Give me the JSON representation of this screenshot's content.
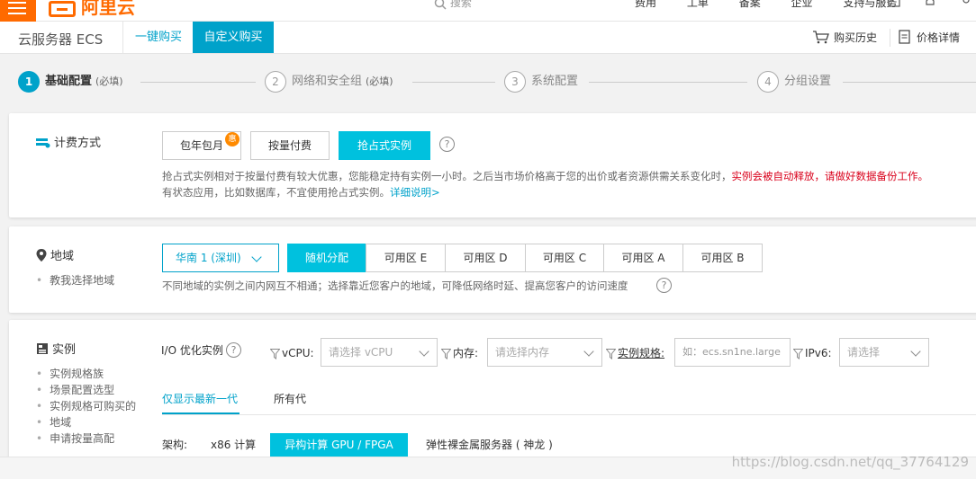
{
  "topbar": {
    "logo_text": "阿里云",
    "search_placeholder": "搜索",
    "nav": [
      "费用",
      "工单",
      "备案",
      "企业",
      "支持与服务"
    ],
    "brand_color": "#ff6a00"
  },
  "header": {
    "product_title": "云服务器 ECS",
    "tab_quick": "一键购买",
    "tab_custom": "自定义购买",
    "purchase_history": "购买历史",
    "price_detail": "价格详情",
    "accent_color": "#00a2ca"
  },
  "steps": [
    {
      "num": "1",
      "label": "基础配置",
      "req": "(必填)",
      "active": true
    },
    {
      "num": "2",
      "label": "网络和安全组",
      "req": "(必填)",
      "active": false
    },
    {
      "num": "3",
      "label": "系统配置",
      "req": "",
      "active": false
    },
    {
      "num": "4",
      "label": "分组设置",
      "req": "",
      "active": false
    }
  ],
  "billing": {
    "title": "计费方式",
    "options": [
      "包年包月",
      "按量付费",
      "抢占式实例"
    ],
    "selected": "抢占式实例",
    "badge": "惠",
    "help": "?",
    "desc_line1": "抢占式实例相对于按量付费有较大优惠，您能稳定持有实例一小时。之后当市场价格高于您的出价或者资源供需关系变化时，",
    "desc_warn": "实例会被自动释放，请做好数据备份工作。",
    "desc_line2": "有状态应用，比如数据库，不宜使用抢占式实例。",
    "desc_link": "详细说明>"
  },
  "region": {
    "title": "地域",
    "sub_link": "教我选择地域",
    "selected_region": "华南 1 (深圳)",
    "zones": [
      "随机分配",
      "可用区 E",
      "可用区 D",
      "可用区 C",
      "可用区 A",
      "可用区 B"
    ],
    "selected_zone": "随机分配",
    "desc": "不同地域的实例之间内网互不相通；选择靠近您客户的地域，可降低网络时延、提高您客户的访问速度",
    "help": "?"
  },
  "instance": {
    "title": "实例",
    "sub_links": [
      "实例规格族",
      "场景配置选型",
      "实例规格可购买的",
      "地域",
      "申请按量高配"
    ],
    "io_label": "I/O 优化实例",
    "help": "?",
    "filters": {
      "vcpu_label": "vCPU:",
      "vcpu_placeholder": "请选择 vCPU",
      "mem_label": "内存:",
      "mem_placeholder": "请选择内存",
      "spec_label": "实例规格:",
      "spec_placeholder": "如：ecs.sn1ne.large",
      "ipv6_label": "IPv6:",
      "ipv6_placeholder": "请选择"
    },
    "gen_tabs": [
      "仅显示最新一代",
      "所有代"
    ],
    "arch_label": "架构:",
    "arch_options": [
      "x86 计算",
      "异构计算 GPU / FPGA",
      "弹性裸金属服务器 ( 神龙 )"
    ],
    "arch_selected": "异构计算 GPU / FPGA"
  },
  "watermark": "https://blog.csdn.net/qq_37764129"
}
